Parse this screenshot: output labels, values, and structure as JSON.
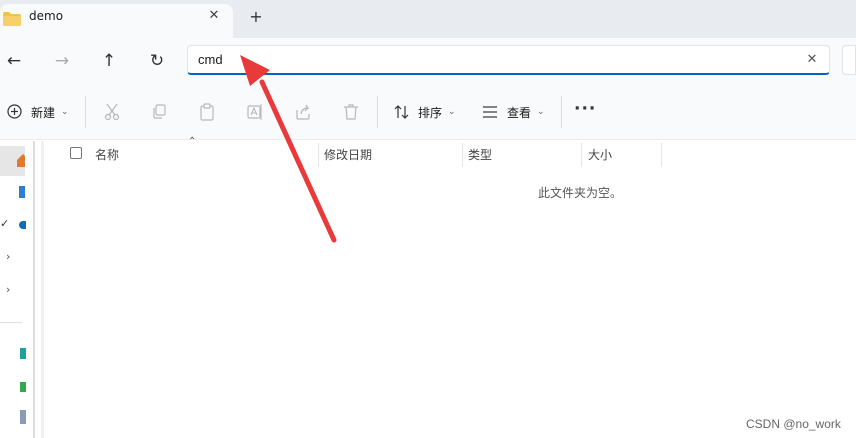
{
  "tab": {
    "title": "demo",
    "close": "✕",
    "new_tab": "+"
  },
  "nav": {
    "back": "←",
    "forward": "→",
    "up": "↑",
    "refresh": "↻",
    "address_value": "cmd",
    "clear": "✕"
  },
  "toolbar": {
    "new_label": "新建",
    "sort_label": "排序",
    "view_label": "查看",
    "more": "···"
  },
  "columns": [
    "名称",
    "修改日期",
    "类型",
    "大小"
  ],
  "empty_message": "此文件夹为空。",
  "watermark": "CSDN @no_work",
  "colors": {
    "accent": "#0067c0",
    "arrow": "#e83a3a",
    "folder": "#f2c14e"
  }
}
